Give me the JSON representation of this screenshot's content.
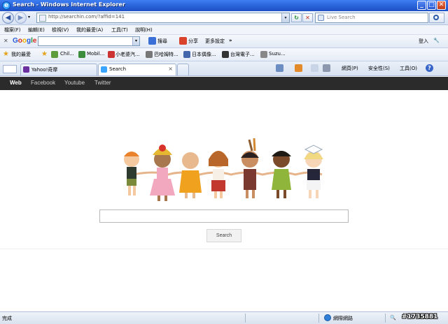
{
  "window": {
    "title": "Search - Windows Internet Explorer",
    "logo_letter": "e"
  },
  "window_buttons": {
    "minimize": "_",
    "maximize": "□",
    "close": "✕"
  },
  "address": {
    "url": "http://searchin.com/?affid=141",
    "back": "◀",
    "forward": "▶",
    "dropdown": "▾",
    "refresh": "↻",
    "stop": "✕"
  },
  "live_search": {
    "placeholder": "Live Search"
  },
  "menu": [
    "檔案(F)",
    "編輯(E)",
    "檢視(V)",
    "我的最愛(A)",
    "工具(T)",
    "說明(H)"
  ],
  "google_toolbar": {
    "close": "✕",
    "logo": [
      {
        "ch": "G",
        "color": "#2a5bd7"
      },
      {
        "ch": "o",
        "color": "#d62d20"
      },
      {
        "ch": "o",
        "color": "#f0b400"
      },
      {
        "ch": "g",
        "color": "#2a5bd7"
      },
      {
        "ch": "l",
        "color": "#1f9e3a"
      },
      {
        "ch": "e",
        "color": "#d62d20"
      }
    ],
    "search_label": "搜尋",
    "share_label": "分享",
    "more_label": "更多設定",
    "more_arrows": "»",
    "login_label": "登入",
    "settings_icon": "wrench-icon"
  },
  "favorites_bar": {
    "favorites_label": "我的最愛",
    "items": [
      "Chil...",
      "Mobil...",
      "小老婆汽...",
      "巴哈姆特...",
      "日本偶像...",
      "台灣電子...",
      "Suzu..."
    ]
  },
  "tabs": [
    {
      "label": "Yahoo!奇摩",
      "active": false
    },
    {
      "label": "Search",
      "active": true
    }
  ],
  "tab_close": "×",
  "command_bar": {
    "page_label": "網頁(P)",
    "safety_label": "安全性(S)",
    "tools_label": "工具(O)",
    "help_icon": "?"
  },
  "page": {
    "nav": [
      "Web",
      "Facebook",
      "Youtube",
      "Twitter"
    ],
    "search_placeholder": "",
    "search_button": "Search"
  },
  "status_bar": {
    "status": "完成",
    "zone": "網際網路",
    "zoom": "100%"
  },
  "watermark": "#1735881",
  "colors": {
    "page_nav_bg": "#2b2b2b",
    "title_bar": "#2a63d8"
  }
}
